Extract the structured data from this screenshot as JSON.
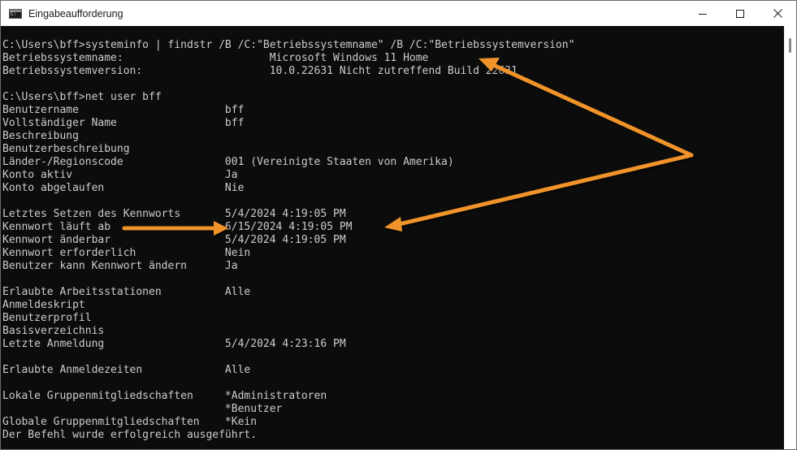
{
  "window": {
    "title": "Eingabeaufforderung",
    "icon": "command-prompt-icon",
    "controls": [
      "minimize-icon",
      "maximize-icon",
      "close-icon"
    ]
  },
  "console": {
    "lines": [
      "C:\\Users\\bff>systeminfo | findstr /B /C:\"Betriebssystemname\" /B /C:\"Betriebssystemversion\"",
      "Betriebssystemname:                       Microsoft Windows 11 Home",
      "Betriebssystemversion:                    10.0.22631 Nicht zutreffend Build 22631",
      "",
      "C:\\Users\\bff>net user bff",
      "Benutzername                       bff",
      "Vollständiger Name                 bff",
      "Beschreibung",
      "Benutzerbeschreibung",
      "Länder-/Regionscode                001 (Vereinigte Staaten von Amerika)",
      "Konto aktiv                        Ja",
      "Konto abgelaufen                   Nie",
      "",
      "Letztes Setzen des Kennworts       5/4/2024 4:19:05 PM",
      "Kennwort läuft ab                  6/15/2024 4:19:05 PM",
      "Kennwort änderbar                  5/4/2024 4:19:05 PM",
      "Kennwort erforderlich              Nein",
      "Benutzer kann Kennwort ändern      Ja",
      "",
      "Erlaubte Arbeitsstationen          Alle",
      "Anmeldeskript",
      "Benutzerprofil",
      "Basisverzeichnis",
      "Letzte Anmeldung                   5/4/2024 4:23:16 PM",
      "",
      "Erlaubte Anmeldezeiten             Alle",
      "",
      "Lokale Gruppenmitgliedschaften     *Administratoren",
      "                                   *Benutzer",
      "Globale Gruppenmitgliedschaften    *Kein",
      "Der Befehl wurde erfolgreich ausgeführt."
    ]
  },
  "annotation": {
    "arrow_color": "#f0932b"
  }
}
